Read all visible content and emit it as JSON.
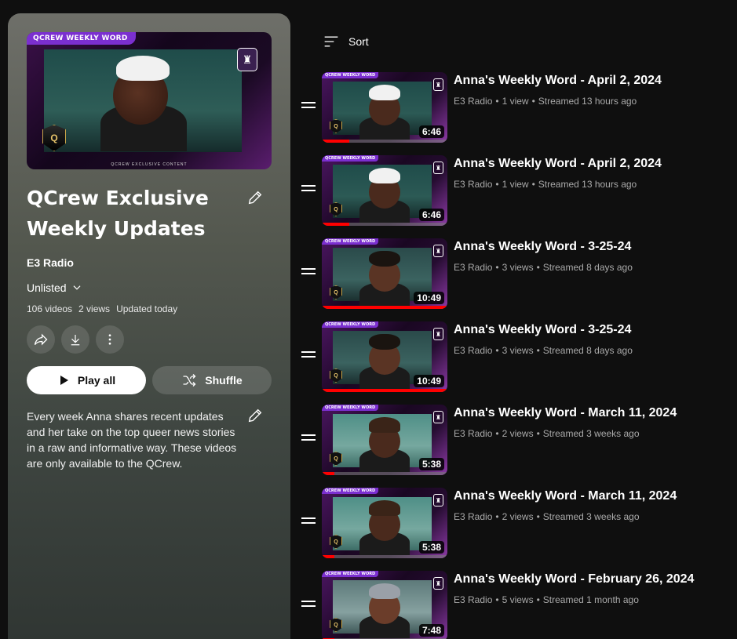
{
  "playlist": {
    "thumbnail": {
      "banner": "QCREW WEEKLY WORD",
      "footer": "QCREW EXCLUSIVE CONTENT",
      "badge_letter": "Q"
    },
    "title_line1": "QCrew Exclusive",
    "title_line2": "Weekly Updates",
    "channel": "E3 Radio",
    "privacy": "Unlisted",
    "stats": {
      "videos": "106 videos",
      "views": "2 views",
      "updated": "Updated today"
    },
    "play_all_label": "Play all",
    "shuffle_label": "Shuffle",
    "description": "Every week Anna shares recent updates and her take on the top queer news stories in a raw and informative way. These videos are only available to the QCrew.",
    "icons": [
      "edit-icon",
      "chevron-down-icon",
      "share-icon",
      "download-icon",
      "more-vert-icon",
      "play-icon",
      "shuffle-icon"
    ]
  },
  "sort": {
    "label": "Sort",
    "icon": "sort-icon"
  },
  "thumb_text": {
    "banner": "QCREW WEEKLY WORD",
    "badge": "Q"
  },
  "videos": [
    {
      "title": "Anna's Weekly Word - April 2, 2024",
      "channel": "E3 Radio",
      "views": "1 view",
      "age": "Streamed 13 hours ago",
      "duration": "6:46",
      "progress": 0.22,
      "look": "cap"
    },
    {
      "title": "Anna's Weekly Word - April 2, 2024",
      "channel": "E3 Radio",
      "views": "1 view",
      "age": "Streamed 13 hours ago",
      "duration": "6:46",
      "progress": 0.22,
      "look": "cap"
    },
    {
      "title": "Anna's Weekly Word - 3-25-24",
      "channel": "E3 Radio",
      "views": "3 views",
      "age": "Streamed 8 days ago",
      "duration": "10:49",
      "progress": 1.0,
      "look": "locs"
    },
    {
      "title": "Anna's Weekly Word - 3-25-24",
      "channel": "E3 Radio",
      "views": "3 views",
      "age": "Streamed 8 days ago",
      "duration": "10:49",
      "progress": 1.0,
      "look": "locs"
    },
    {
      "title": "Anna's Weekly Word - March 11, 2024",
      "channel": "E3 Radio",
      "views": "2 views",
      "age": "Streamed 3 weeks ago",
      "duration": "5:38",
      "progress": 0.1,
      "look": "beanie"
    },
    {
      "title": "Anna's Weekly Word - March 11, 2024",
      "channel": "E3 Radio",
      "views": "2 views",
      "age": "Streamed 3 weeks ago",
      "duration": "5:38",
      "progress": 0.1,
      "look": "beanie"
    },
    {
      "title": "Anna's Weekly Word - February 26, 2024",
      "channel": "E3 Radio",
      "views": "5 views",
      "age": "Streamed 1 month ago",
      "duration": "7:48",
      "progress": 0.1,
      "look": "greycap"
    }
  ],
  "colors": {
    "background": "#0f0f0f",
    "meta_text": "#aaaaaa",
    "progress": "#ff0000",
    "banner": "#7b2fd0"
  }
}
